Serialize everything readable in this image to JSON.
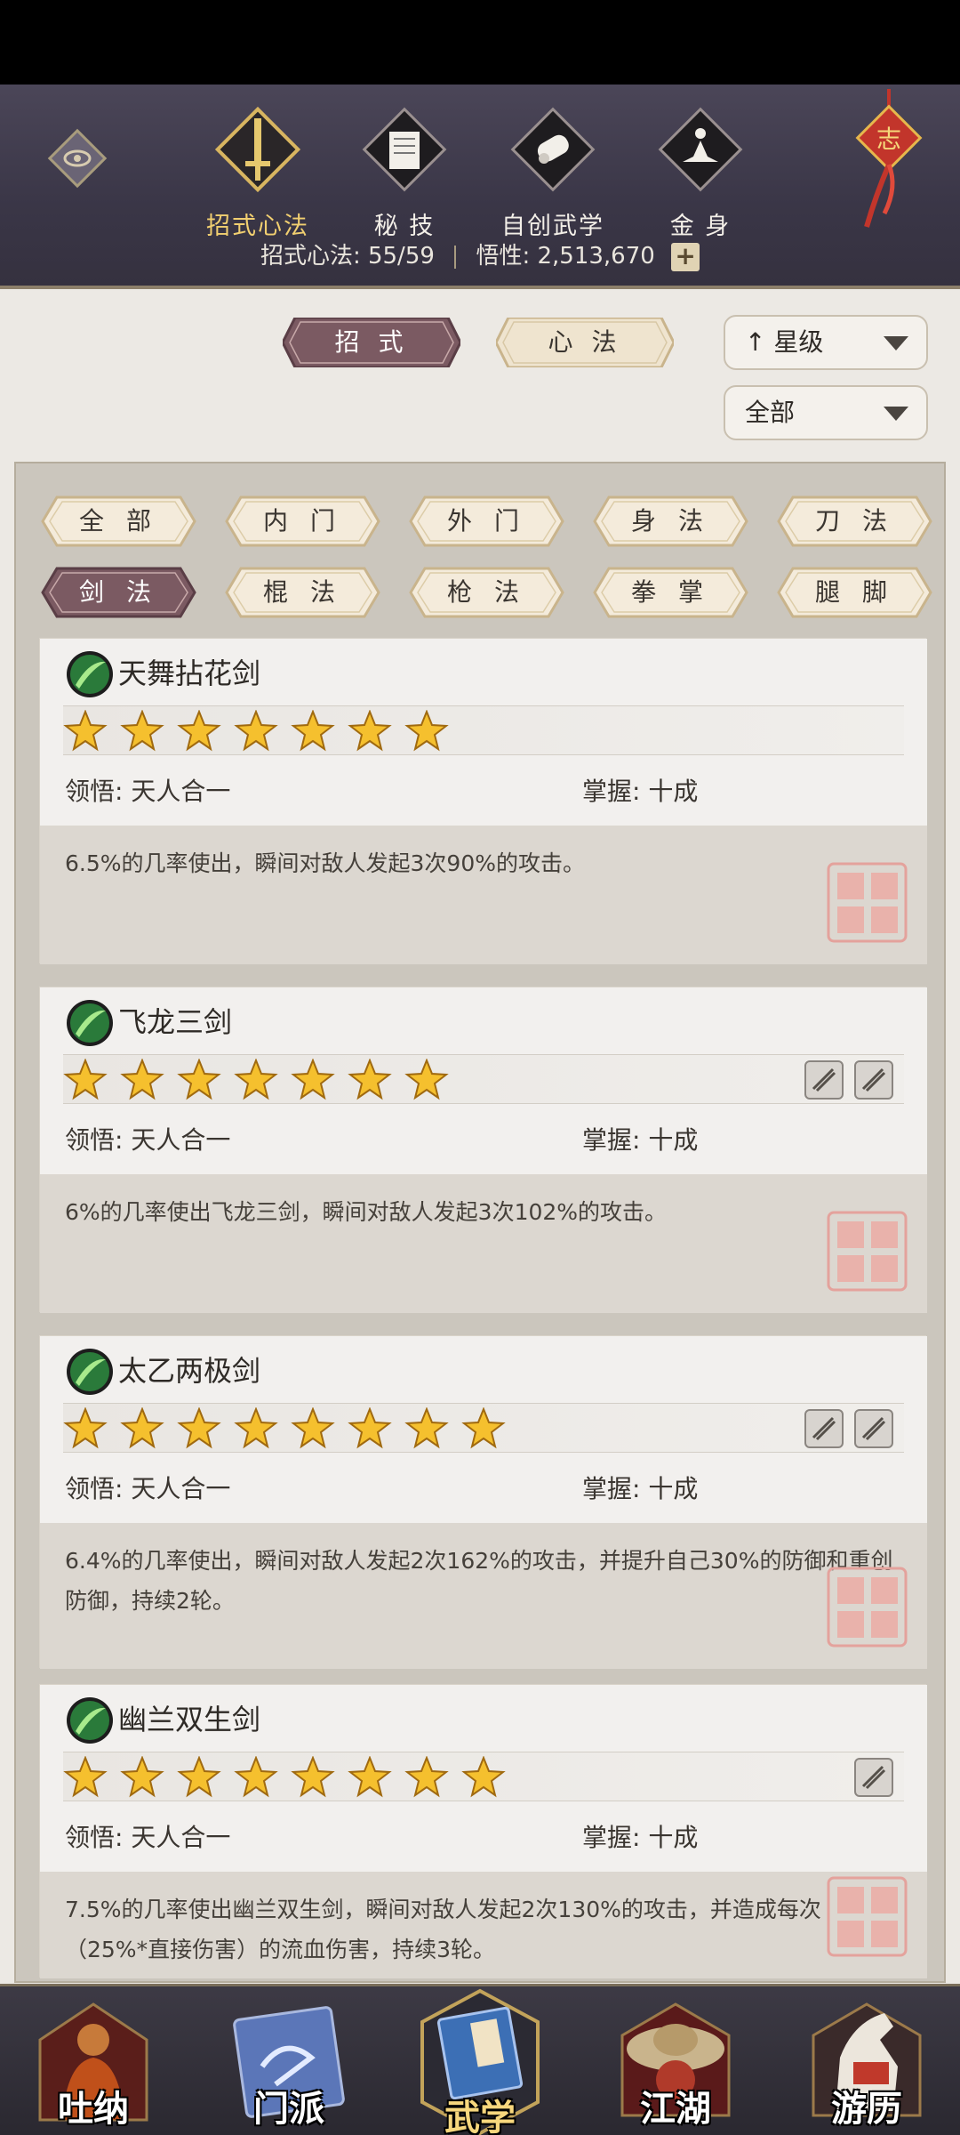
{
  "top_nav": {
    "items": [
      {
        "label": "招式心法",
        "icon": "sword-icon",
        "active": true
      },
      {
        "label": "秘 技",
        "icon": "book-icon",
        "active": false
      },
      {
        "label": "自创武学",
        "icon": "scroll-icon",
        "active": false
      },
      {
        "label": "金 身",
        "icon": "meditation-icon",
        "active": false
      }
    ],
    "knot_label": "志",
    "stats": {
      "skills_label": "招式心法:",
      "skills_value": "55/59",
      "insight_label": "悟性:",
      "insight_value": "2,513,670",
      "plus": "+"
    }
  },
  "filters": {
    "tab_moves": "招 式",
    "tab_heart": "心 法",
    "sort_label": "星级",
    "sort_arrow": "↑",
    "scope_label": "全部"
  },
  "categories": [
    "全 部",
    "内 门",
    "外 门",
    "身 法",
    "刀 法",
    "剑 法",
    "棍 法",
    "枪 法",
    "拳 掌",
    "腿 脚"
  ],
  "active_category": "剑 法",
  "skills": [
    {
      "name": "天舞拈花剑",
      "stars": 7,
      "comprehension_label": "领悟:",
      "comprehension": "天人合一",
      "mastery_label": "掌握:",
      "mastery": "十成",
      "description": "6.5%的几率使出，瞬间对敌人发起3次90%的攻击。",
      "tags": []
    },
    {
      "name": "飞龙三剑",
      "stars": 7,
      "comprehension_label": "领悟:",
      "comprehension": "天人合一",
      "mastery_label": "掌握:",
      "mastery": "十成",
      "description": "6%的几率使出飞龙三剑，瞬间对敌人发起3次102%的攻击。",
      "tags": [
        "slash-tag-icon",
        "dragon-tag-icon"
      ]
    },
    {
      "name": "太乙两极剑",
      "stars": 8,
      "comprehension_label": "领悟:",
      "comprehension": "天人合一",
      "mastery_label": "掌握:",
      "mastery": "十成",
      "description": "6.4%的几率使出，瞬间对敌人发起2次162%的攻击，并提升自己30%的防御和重创防御，持续2轮。",
      "tags": [
        "shield-tag-icon",
        "yinyang-tag-icon"
      ]
    },
    {
      "name": "幽兰双生剑",
      "stars": 8,
      "comprehension_label": "领悟:",
      "comprehension": "天人合一",
      "mastery_label": "掌握:",
      "mastery": "十成",
      "description": "7.5%的几率使出幽兰双生剑，瞬间对敌人发起2次130%的攻击，并造成每次（25%*直接伤害）的流血伤害，持续3轮。",
      "tags": [
        "crossed-swords-tag-icon"
      ]
    }
  ],
  "bottom_nav": [
    {
      "label": "吐纳",
      "icon": "monk-icon"
    },
    {
      "label": "门派",
      "icon": "dragon-banner-icon"
    },
    {
      "label": "武学",
      "icon": "martial-book-icon",
      "active": true
    },
    {
      "label": "江湖",
      "icon": "straw-hat-icon"
    },
    {
      "label": "游历",
      "icon": "horse-icon"
    }
  ],
  "colors": {
    "accent_gold": "#f1cf70",
    "tab_active": "#7b5a62",
    "tab_inactive": "#efe4cf",
    "seal_red": "#d77a72",
    "nav_bg": "#3a3647"
  }
}
